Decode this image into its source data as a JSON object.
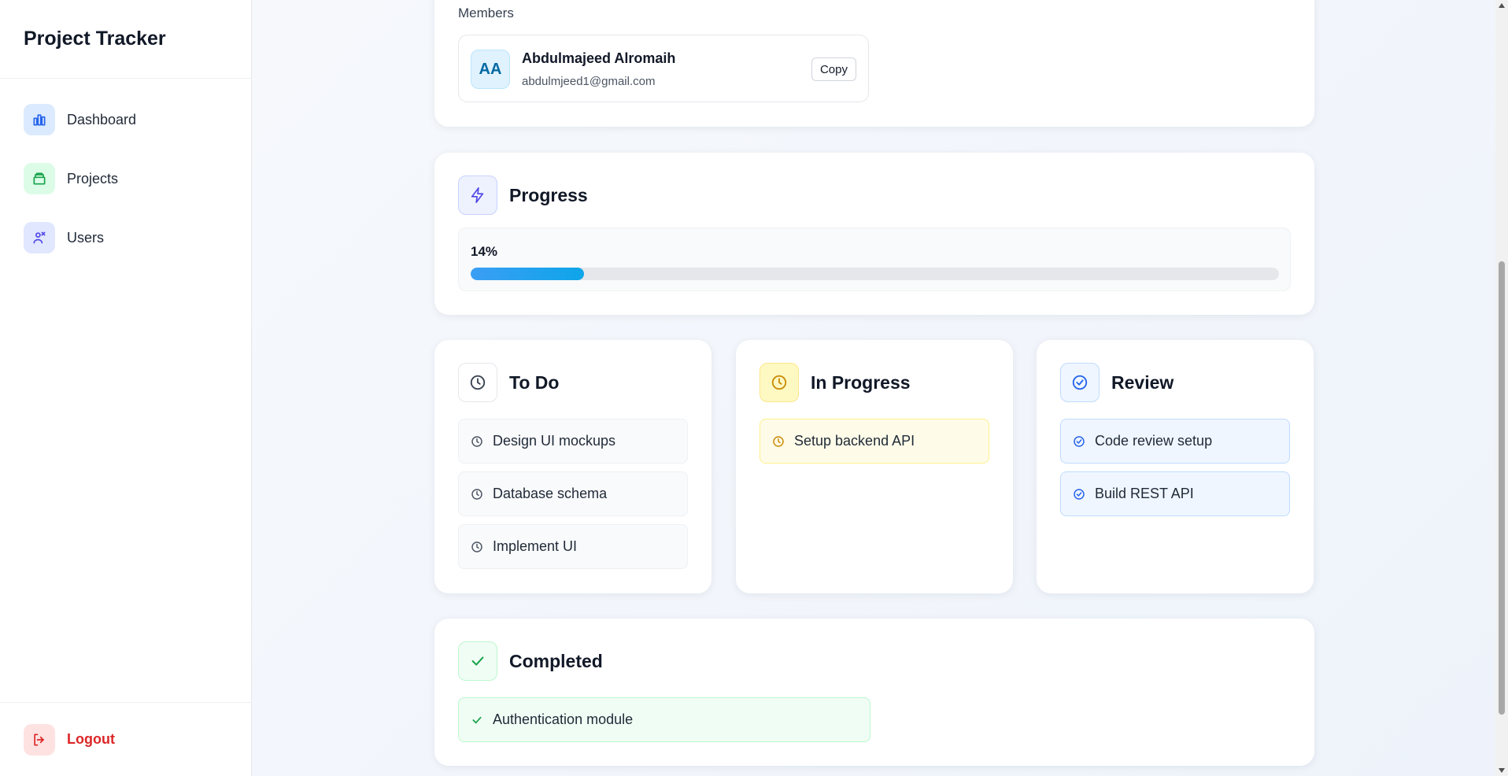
{
  "sidebar": {
    "brand": "Project Tracker",
    "items": [
      {
        "label": "Dashboard",
        "icon": "bar-chart-icon"
      },
      {
        "label": "Projects",
        "icon": "folder-icon"
      },
      {
        "label": "Users",
        "icon": "users-icon"
      }
    ],
    "logout": "Logout"
  },
  "members": {
    "title": "Members",
    "list": [
      {
        "initials": "AA",
        "name": "Abdulmajeed Alromaih",
        "email": "abdulmjeed1@gmail.com",
        "copy_label": "Copy"
      }
    ]
  },
  "progress": {
    "title": "Progress",
    "label": "14%",
    "value": 0.14
  },
  "columns": {
    "todo": {
      "title": "To Do",
      "tasks": [
        "Design UI mockups",
        "Database schema",
        "Implement UI"
      ]
    },
    "in_progress": {
      "title": "In Progress",
      "tasks": [
        "Setup backend API"
      ]
    },
    "review": {
      "title": "Review",
      "tasks": [
        "Code review setup",
        "Build REST API"
      ]
    },
    "completed": {
      "title": "Completed",
      "tasks": [
        "Authentication module"
      ]
    }
  },
  "colors": {
    "todo": "#4b5563",
    "in_progress": "#ca8a04",
    "review": "#2563eb",
    "completed": "#16a34a",
    "progress_fill": "#3b9ef5",
    "logout": "#dc2626"
  }
}
